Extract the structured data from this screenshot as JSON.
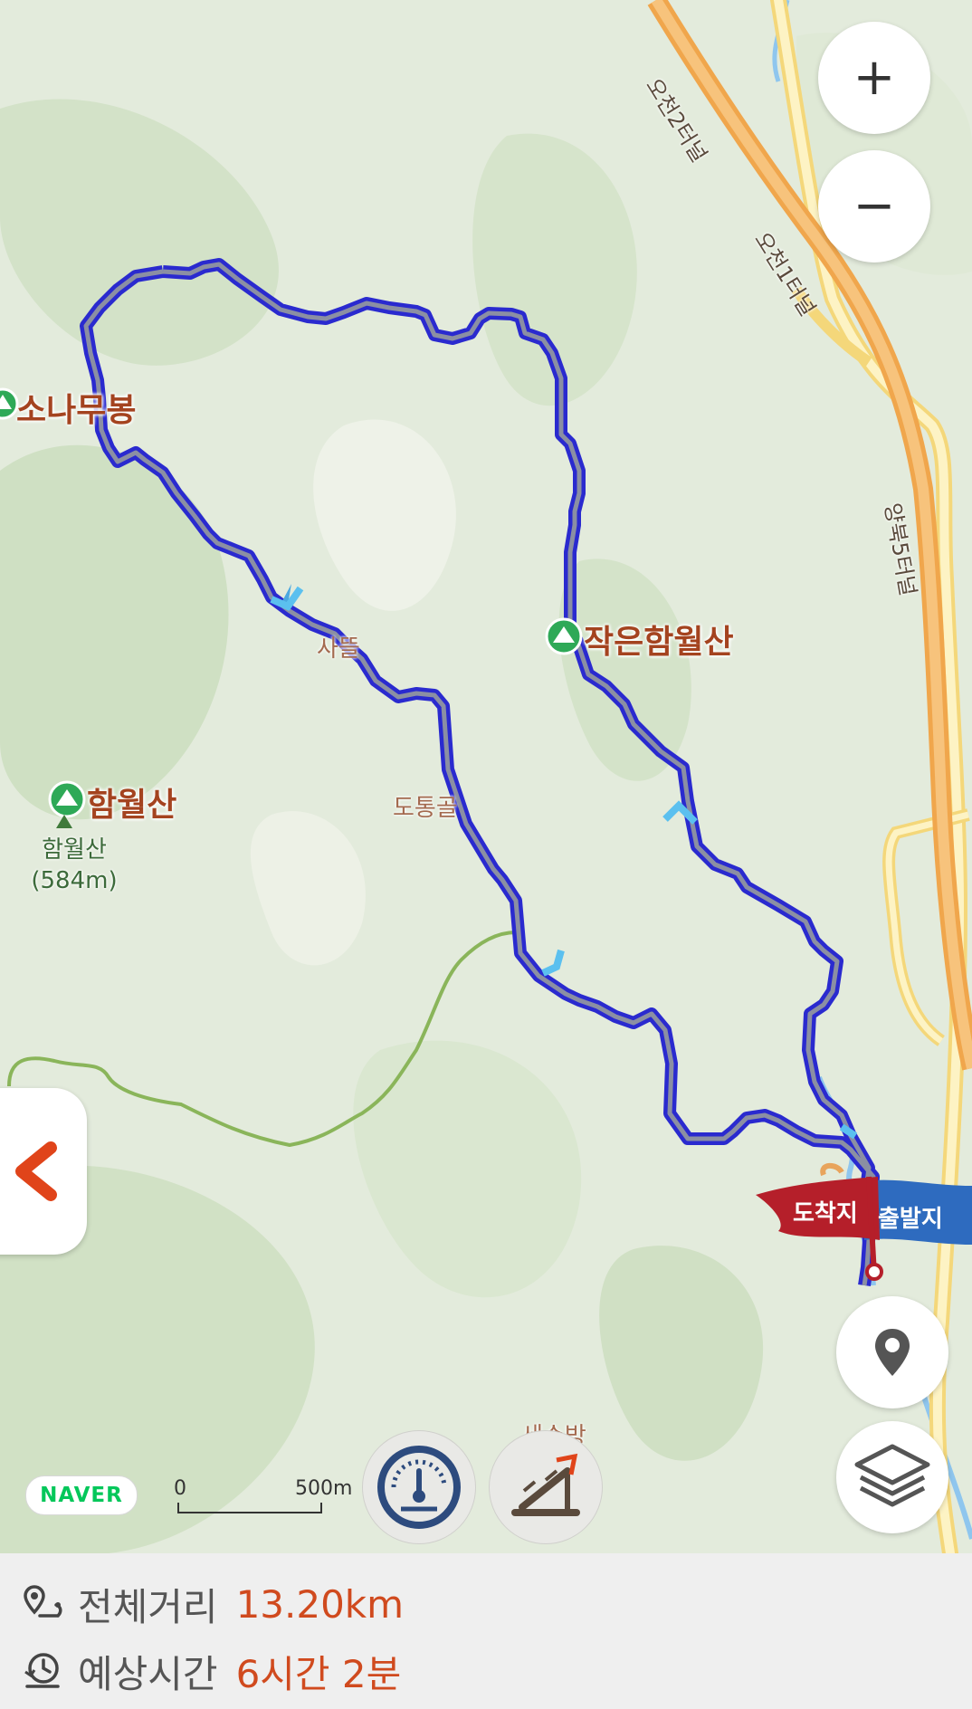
{
  "map": {
    "peaks": {
      "sonamu": "소나무봉",
      "small_hamwol": "작은함월산",
      "hamwol": "함월산",
      "hamwol_marker_name": "함월산",
      "hamwol_marker_elev": "(584m)"
    },
    "places": {
      "satteul": "사뜰",
      "dotong": "도통골",
      "seosubang": "세수방"
    },
    "roads": {
      "tunnel_2": "오천2터널",
      "tunnel_1": "오천1터널",
      "tunnel_5": "양북5터널"
    },
    "markers": {
      "arrival": "도착지",
      "departure": "출발지"
    },
    "attribution": "NAVER",
    "scale": {
      "start": "0",
      "end": "500m"
    },
    "route_color": "#2a2acf",
    "start_flag_color": "#2e6bbf",
    "end_flag_color": "#b51f2a"
  },
  "controls": {
    "zoom_in": "+",
    "zoom_out": "−"
  },
  "info": {
    "distance_label": "전체거리",
    "distance_value": "13.20km",
    "time_label": "예상시간",
    "time_value": "6시간 2분"
  }
}
